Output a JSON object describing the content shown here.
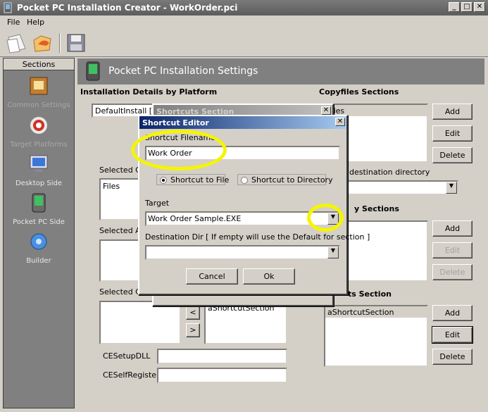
{
  "window": {
    "title": "Pocket PC Installation Creator - WorkOrder.pci",
    "min": "_",
    "max": "□",
    "close": "✕"
  },
  "menu": {
    "file": "File",
    "help": "Help"
  },
  "sidebar": {
    "header": "Sections",
    "items": [
      {
        "label": "Common Settings",
        "icon": "common-settings-icon",
        "dim": true
      },
      {
        "label": "Target Platforms",
        "icon": "target-icon",
        "dim": true
      },
      {
        "label": "Desktop Side",
        "icon": "monitor-icon",
        "dim": false
      },
      {
        "label": "Pocket PC Side",
        "icon": "pda-icon",
        "dim": false
      },
      {
        "label": "Builder",
        "icon": "gear-icon",
        "dim": false
      }
    ]
  },
  "banner": {
    "title": "Pocket PC Installation Settings"
  },
  "left_panel": {
    "title": "Installation Details by Platform",
    "platform_item": "DefaultInstall [ D",
    "selected_co": "Selected Co",
    "files_item": "Files",
    "selected_ad": "Selected Ad",
    "selected_ce": "Selected CE",
    "ce_item": "aShortcutSection",
    "arrow_left": "<",
    "arrow_right": ">",
    "cesetupdll": "CESetupDLL",
    "ceselfregister": "CESelfRegister"
  },
  "right_panel": {
    "copyfiles_title": "Copyfiles Sections",
    "copyfiles_item": "Files",
    "dest_label": "destination directory",
    "registry_title": "y Sections",
    "shortcuts_title": "ts Section",
    "shortcuts_item": "aShortcutSection",
    "add": "Add",
    "edit": "Edit",
    "delete": "Delete"
  },
  "shortcuts_dialog": {
    "title": "Shortcuts Section"
  },
  "shortcut_editor": {
    "title": "Shortcut Editor",
    "filename_label": "Shortcut Filename",
    "filename_value": "Work Order",
    "radio_file": "Shortcut to File",
    "radio_dir": "Shortcut to Directory",
    "target_label": "Target",
    "target_value": "Work Order Sample.EXE",
    "dest_label": "Destination Dir [ If empty will use the Default for section ]",
    "dest_value": "",
    "cancel": "Cancel",
    "ok": "Ok"
  }
}
